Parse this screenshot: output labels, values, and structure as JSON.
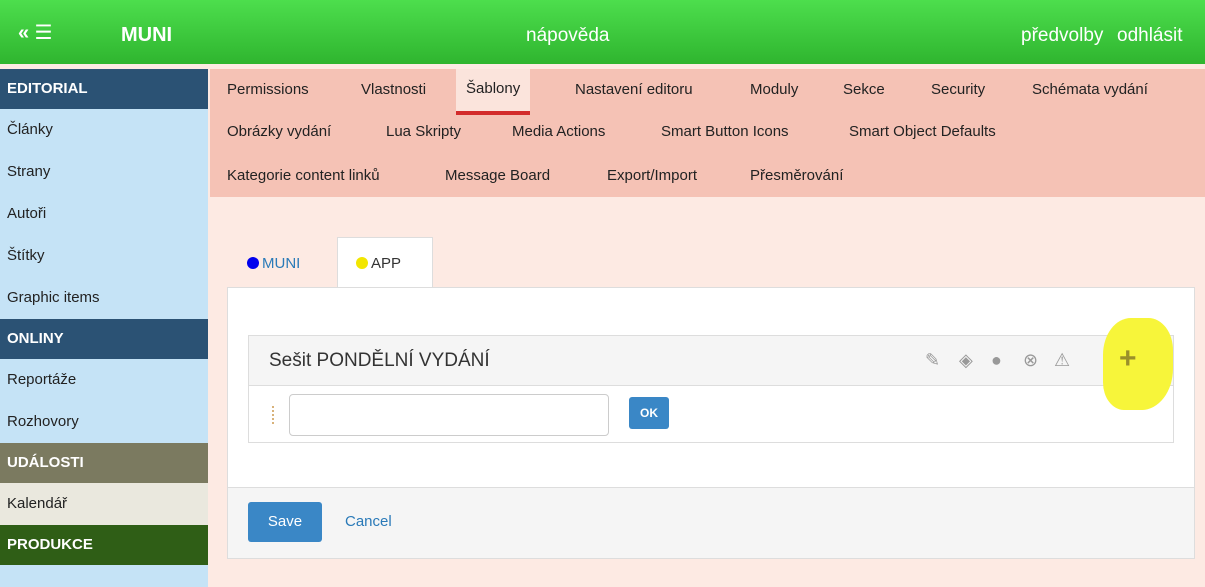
{
  "topbar": {
    "menu_icon": "« ☰",
    "brand": "MUNI",
    "help": "nápověda",
    "preferences": "předvolby",
    "logout": "odhlásit",
    "color": "#2fb52f"
  },
  "sidebar": {
    "items": [
      {
        "label": "EDITORIAL",
        "type": "header"
      },
      {
        "label": "Články"
      },
      {
        "label": "Strany"
      },
      {
        "label": "Autoři"
      },
      {
        "label": "Štítky"
      },
      {
        "label": "Graphic items"
      },
      {
        "label": "ONLINY",
        "type": "header"
      },
      {
        "label": "Reportáže"
      },
      {
        "label": "Rozhovory"
      },
      {
        "label": "UDÁLOSTI",
        "type": "header"
      },
      {
        "label": "Kalendář"
      },
      {
        "label": "PRODUKCE",
        "type": "header"
      }
    ]
  },
  "tabs": [
    {
      "label": "Permissions"
    },
    {
      "label": "Vlastnosti"
    },
    {
      "label": "Šablony",
      "active": true
    },
    {
      "label": "Nastavení editoru"
    },
    {
      "label": "Moduly"
    },
    {
      "label": "Sekce"
    },
    {
      "label": "Security"
    },
    {
      "label": "Schémata vydání"
    },
    {
      "label": "Obrázky vydání"
    },
    {
      "label": "Lua Skripty"
    },
    {
      "label": "Media Actions"
    },
    {
      "label": "Smart Button Icons"
    },
    {
      "label": "Smart Object Defaults"
    },
    {
      "label": "Kategorie content linků"
    },
    {
      "label": "Message Board"
    },
    {
      "label": "Export/Import"
    },
    {
      "label": "Přesměrování"
    }
  ],
  "subtabs": [
    {
      "label": "MUNI",
      "dot_color": "#0000ee"
    },
    {
      "label": "APP",
      "dot_color": "#f2e600",
      "active": true
    }
  ],
  "group": {
    "title": "Sešit PONDĚLNÍ VYDÁNÍ",
    "icons": [
      "edit-icon",
      "hide-icon",
      "drop-icon",
      "remove-icon",
      "warning-icon",
      "add-icon"
    ],
    "input_value": "",
    "ok_label": "OK"
  },
  "footer": {
    "save_label": "Save",
    "cancel_label": "Cancel"
  }
}
